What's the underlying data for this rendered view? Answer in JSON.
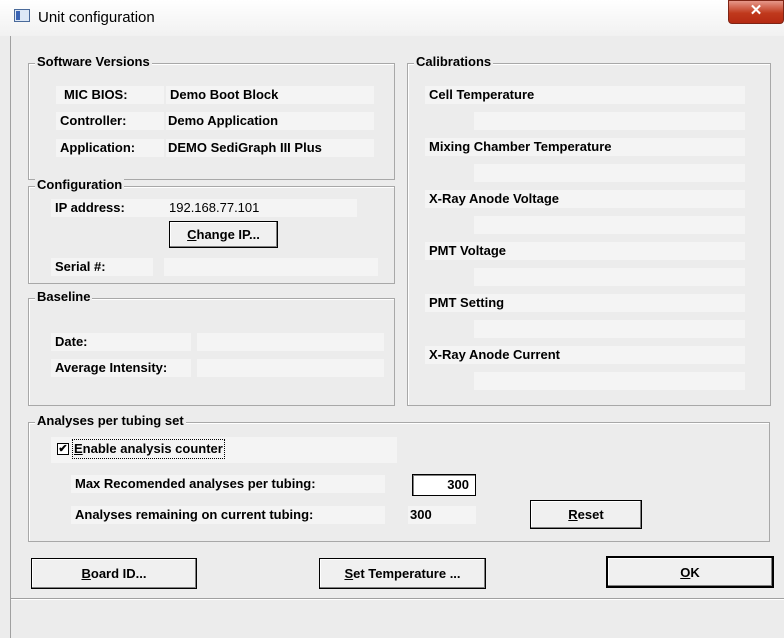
{
  "window": {
    "title": "Unit configuration",
    "close_glyph": "✕"
  },
  "software_versions": {
    "title": "Software Versions",
    "rows": [
      {
        "label": "MIC BIOS:",
        "value": "Demo Boot Block"
      },
      {
        "label": "Controller:",
        "value": "Demo Application"
      },
      {
        "label": "Application:",
        "value": "DEMO SediGraph III Plus"
      }
    ]
  },
  "configuration": {
    "title": "Configuration",
    "ip_label": "IP address:",
    "ip_value": "192.168.77.101",
    "change_ip_button": "Change IP...",
    "serial_label": "Serial #:",
    "serial_value": ""
  },
  "baseline": {
    "title": "Baseline",
    "date_label": "Date:",
    "date_value": "",
    "avg_label": "Average Intensity:",
    "avg_value": ""
  },
  "calibrations": {
    "title": "Calibrations",
    "items": [
      {
        "label": "Cell Temperature",
        "value": ""
      },
      {
        "label": "Mixing Chamber Temperature",
        "value": ""
      },
      {
        "label": "X-Ray Anode Voltage",
        "value": ""
      },
      {
        "label": "PMT Voltage",
        "value": ""
      },
      {
        "label": "PMT Setting",
        "value": ""
      },
      {
        "label": "X-Ray Anode Current",
        "value": ""
      }
    ]
  },
  "analyses": {
    "title": "Analyses per tubing set",
    "enable_label": "Enable analysis counter",
    "enable_checked": true,
    "check_glyph": "✔",
    "max_label": "Max Recomended analyses per tubing:",
    "max_value": "300",
    "remaining_label": "Analyses remaining on current tubing:",
    "remaining_value": "300",
    "reset_button": "Reset"
  },
  "footer": {
    "board_id_button": "Board ID...",
    "set_temperature_button": "Set Temperature ...",
    "ok_button": "OK"
  },
  "status_text": ""
}
